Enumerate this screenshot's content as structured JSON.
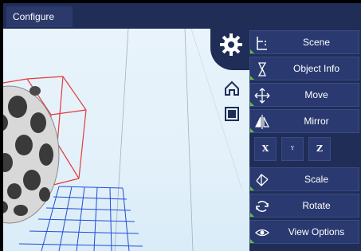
{
  "topbar": {
    "configure_label": "Configure"
  },
  "panel": {
    "items": [
      {
        "label": "Scene",
        "icon": "scene-tree-icon"
      },
      {
        "label": "Object Info",
        "icon": "object-info-icon"
      },
      {
        "label": "Move",
        "icon": "move-arrows-icon"
      },
      {
        "label": "Mirror",
        "icon": "mirror-icon"
      },
      {
        "label": "Scale",
        "icon": "scale-icon"
      },
      {
        "label": "Rotate",
        "icon": "rotate-icon"
      },
      {
        "label": "View Options",
        "icon": "eye-icon"
      }
    ],
    "mirror_axes": {
      "x": "X",
      "y": "Y",
      "z": "Z"
    }
  },
  "colors": {
    "panel_bg": "#1f2d57",
    "button_bg": "#2a3a70",
    "accent_green": "#5cc43a",
    "bbox_red": "#e23b3b",
    "grid_blue": "#1f4fd6"
  }
}
